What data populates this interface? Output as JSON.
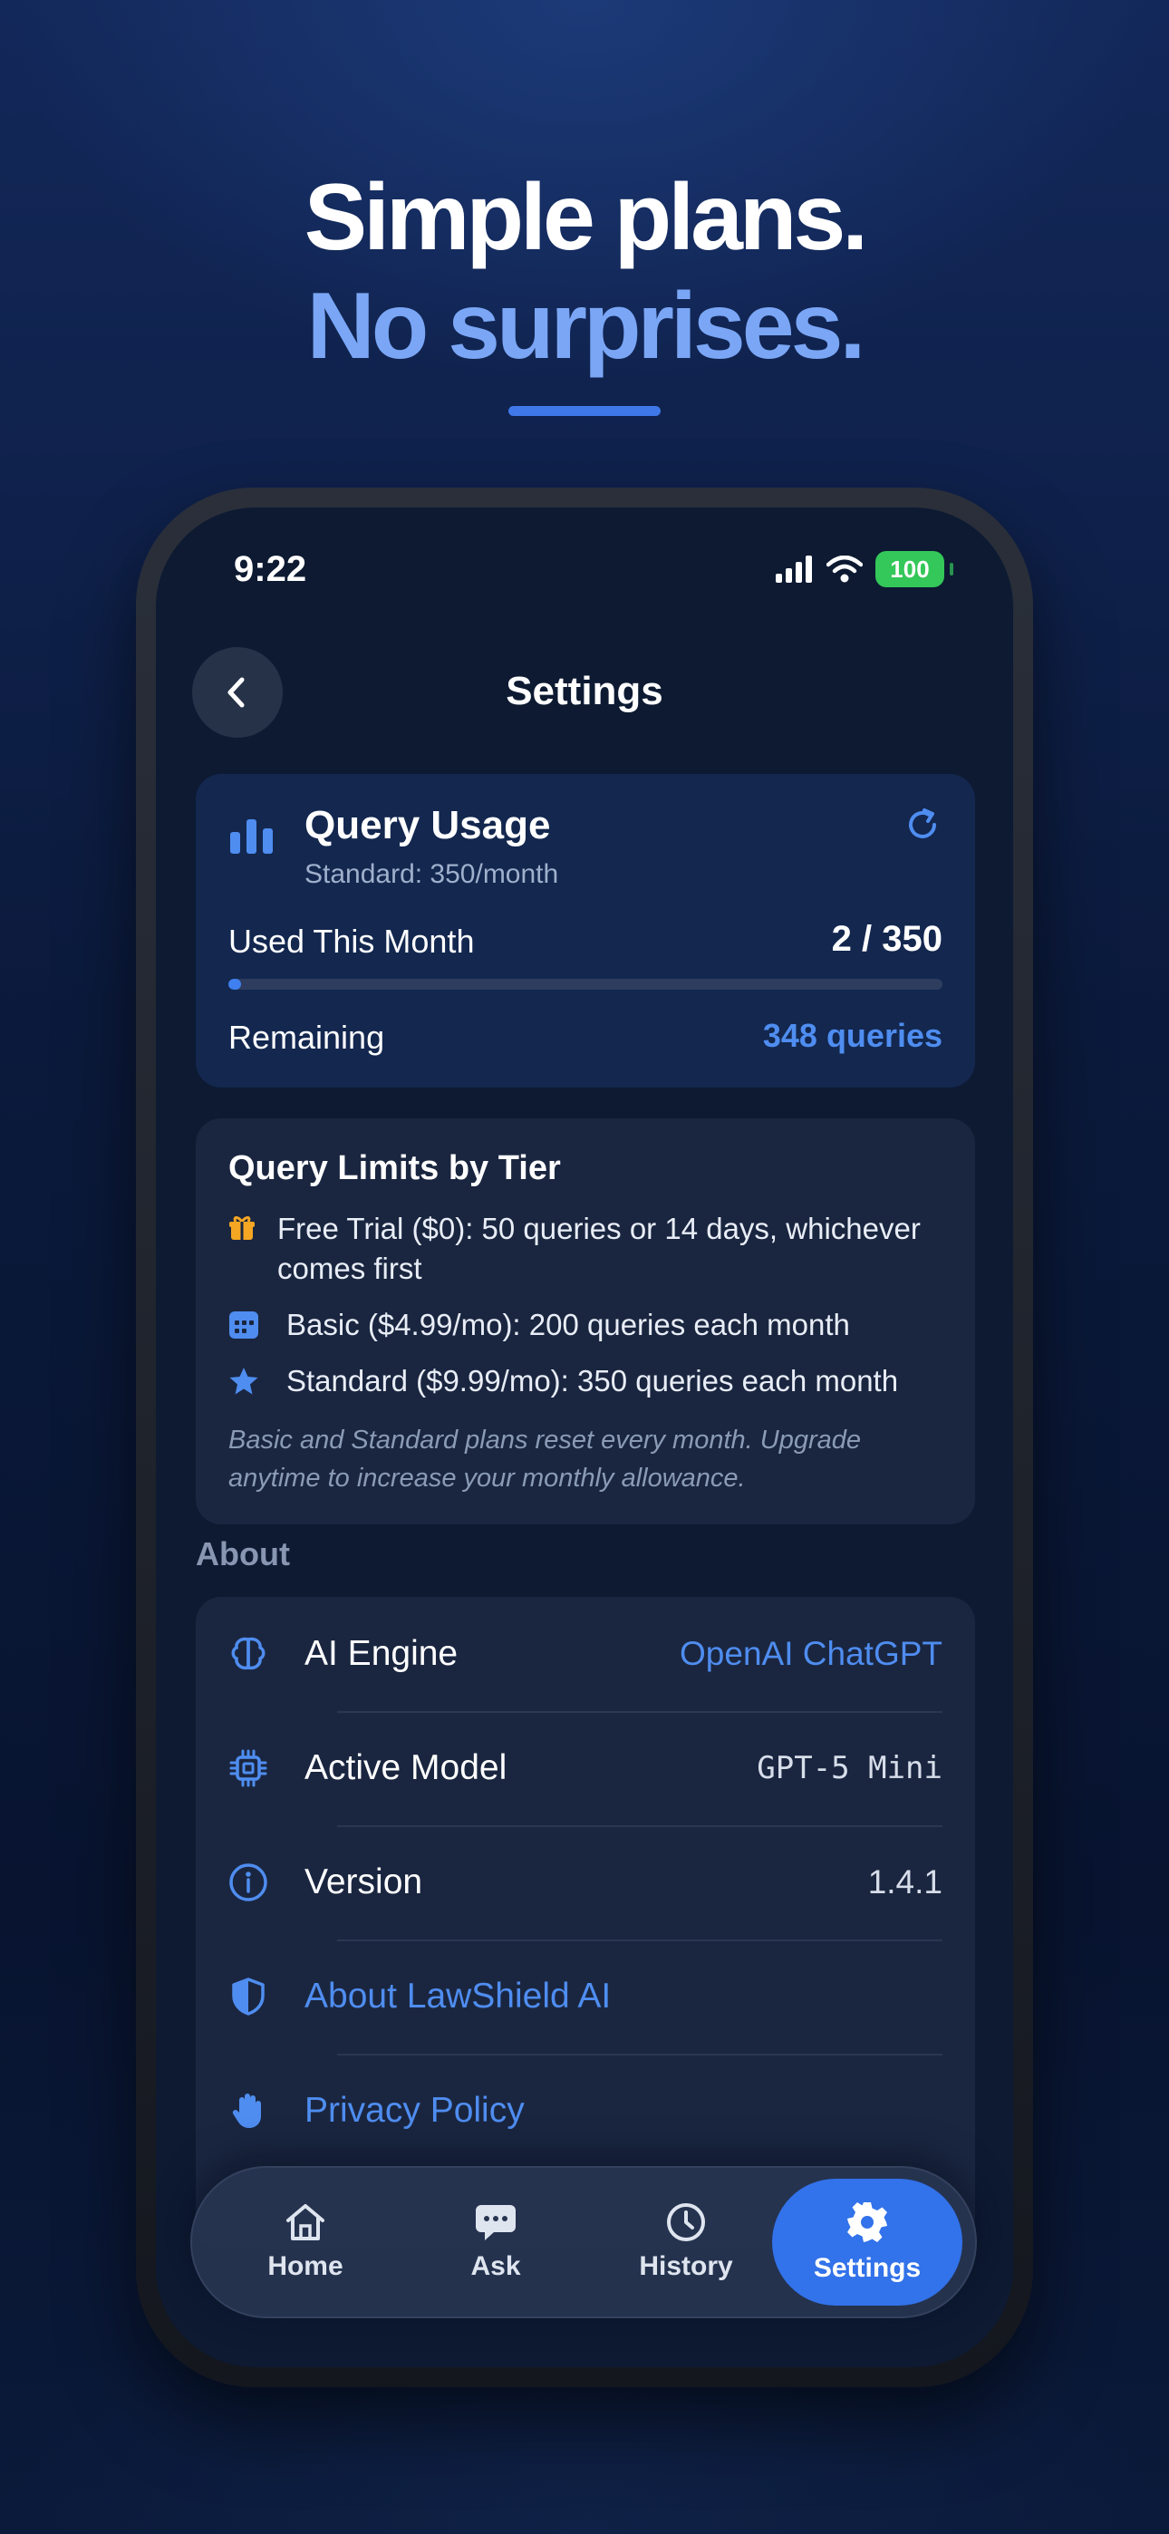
{
  "hero": {
    "line1": "Simple plans.",
    "line2": "No surprises."
  },
  "status_bar": {
    "time": "9:22",
    "battery": "100",
    "icons": [
      "signal-icon",
      "wifi-icon",
      "battery-icon"
    ]
  },
  "header": {
    "title": "Settings",
    "back_icon": "chevron-left-icon"
  },
  "usage": {
    "title": "Query Usage",
    "plan": "Standard: 350/month",
    "used_label": "Used This Month",
    "used_value": "2 / 350",
    "used_fraction": 0.0057,
    "remaining_label": "Remaining",
    "remaining_value": "348 queries",
    "icons": [
      "bar-chart-icon",
      "refresh-icon"
    ]
  },
  "limits": {
    "title": "Query Limits by Tier",
    "tiers": [
      {
        "icon": "gift-icon",
        "text": "Free Trial ($0): 50 queries or 14 days, whichever comes first"
      },
      {
        "icon": "calendar-icon",
        "text": "Basic ($4.99/mo): 200 queries each month"
      },
      {
        "icon": "star-icon",
        "text": "Standard ($9.99/mo): 350 queries each month"
      }
    ],
    "note": "Basic and Standard plans reset every month. Upgrade anytime to increase your monthly allowance."
  },
  "about": {
    "heading": "About",
    "rows": [
      {
        "icon": "brain-icon",
        "label": "AI Engine",
        "value": "OpenAI ChatGPT"
      },
      {
        "icon": "chip-icon",
        "label": "Active Model",
        "value": "GPT-5 Mini"
      },
      {
        "icon": "info-icon",
        "label": "Version",
        "value": "1.4.1"
      },
      {
        "icon": "shield-icon",
        "label": "About LawShield AI",
        "value": ""
      },
      {
        "icon": "hand-icon",
        "label": "Privacy Policy",
        "value": ""
      }
    ]
  },
  "tabs": [
    {
      "icon": "home-icon",
      "label": "Home",
      "active": false
    },
    {
      "icon": "chat-icon",
      "label": "Ask",
      "active": false
    },
    {
      "icon": "clock-icon",
      "label": "History",
      "active": false
    },
    {
      "icon": "gear-icon",
      "label": "Settings",
      "active": true
    }
  ],
  "colors": {
    "accent": "#3272ea",
    "link": "#4f8df0",
    "headline_blue": "#7aa6f5",
    "battery_green": "#34c759",
    "gift_orange": "#f5a623"
  }
}
